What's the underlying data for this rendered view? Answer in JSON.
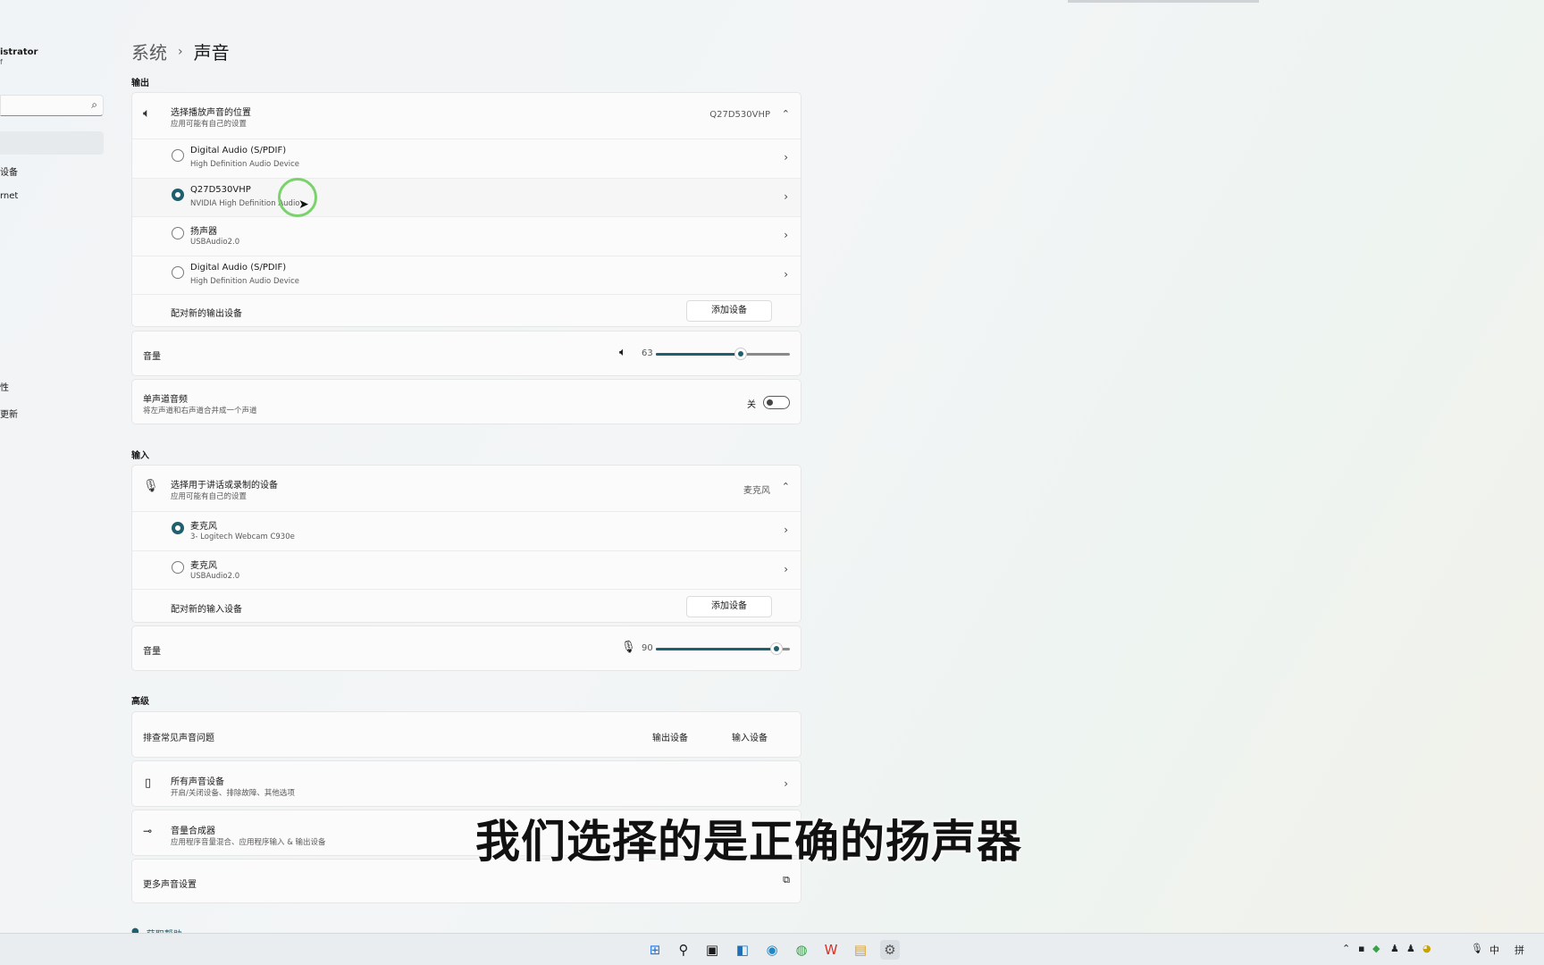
{
  "sidebar": {
    "user_name": "istrator",
    "user_sub": "f",
    "search_icon": "search-icon",
    "items": [
      "设备",
      "rnet",
      "性",
      "更新"
    ]
  },
  "breadcrumb": {
    "parent": "系统",
    "separator": "›",
    "current": "声音"
  },
  "output": {
    "section_title": "输出",
    "selector": {
      "title": "选择播放声音的位置",
      "subtitle": "应用可能有自己的设置",
      "value": "Q27D530VHP"
    },
    "devices": [
      {
        "name": "Digital Audio (S/PDIF)",
        "desc": "High Definition Audio Device",
        "selected": false
      },
      {
        "name": "Q27D530VHP",
        "desc": "NVIDIA High Definition Audio",
        "selected": true
      },
      {
        "name": "扬声器",
        "desc": "USBAudio2.0",
        "selected": false
      },
      {
        "name": "Digital Audio (S/PDIF)",
        "desc": "High Definition Audio Device",
        "selected": false
      }
    ],
    "pair_label": "配对新的输出设备",
    "add_button": "添加设备",
    "volume_label": "音量",
    "volume_value": "63",
    "volume_fraction": 0.63,
    "mono": {
      "title": "单声道音频",
      "subtitle": "将左声道和右声道合并成一个声道",
      "state": "关"
    }
  },
  "input": {
    "section_title": "输入",
    "selector": {
      "title": "选择用于讲话或录制的设备",
      "subtitle": "应用可能有自己的设置",
      "value": "麦克风"
    },
    "devices": [
      {
        "name": "麦克风",
        "desc": "3- Logitech Webcam C930e",
        "selected": true
      },
      {
        "name": "麦克风",
        "desc": "USBAudio2.0",
        "selected": false
      }
    ],
    "pair_label": "配对新的输入设备",
    "add_button": "添加设备",
    "volume_label": "音量",
    "volume_value": "90",
    "volume_fraction": 0.9
  },
  "advanced": {
    "section_title": "高级",
    "troubleshoot": {
      "label": "排查常见声音问题",
      "output_btn": "输出设备",
      "input_btn": "输入设备"
    },
    "all_devices": {
      "title": "所有声音设备",
      "subtitle": "开启/关闭设备、排除故障、其他选项"
    },
    "mixer": {
      "title": "音量合成器",
      "subtitle": "应用程序音量混合、应用程序输入 & 输出设备"
    },
    "more": {
      "label": "更多声音设置"
    }
  },
  "help_text": "获取帮助",
  "caption": "我们选择的是正确的扬声器",
  "taskbar": {
    "tray_ime_lang": "中",
    "tray_ime_mode": "拼"
  },
  "colors": {
    "accent": "#1f5f6e",
    "cursor_ring": "#7ad36a"
  }
}
